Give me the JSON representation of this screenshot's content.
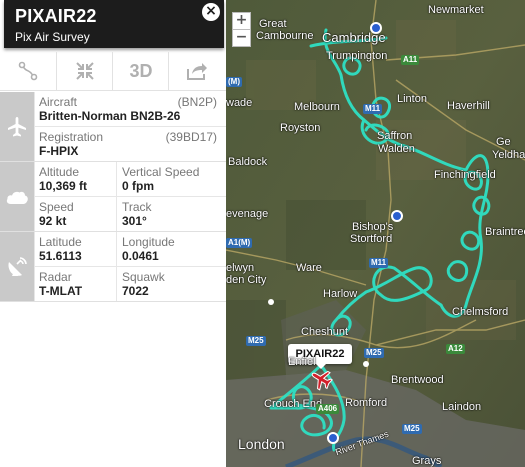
{
  "flight": {
    "callsign": "PIXAIR22",
    "operator": "Pix Air Survey",
    "close_icon": "×"
  },
  "toolbar": {
    "route_icon": "route-icon",
    "fullscreen_icon": "fullscreen-icon",
    "view_3d_label": "3D",
    "share_icon": "share-icon"
  },
  "aircraft": {
    "aircraft_label": "Aircraft",
    "aircraft_code": "(BN2P)",
    "aircraft_value": "Britten-Norman BN2B-26",
    "registration_label": "Registration",
    "registration_code": "(39BD17)",
    "registration_value": "F-HPIX"
  },
  "flight_data": {
    "altitude_label": "Altitude",
    "altitude_value": "10,369 ft",
    "vspeed_label": "Vertical Speed",
    "vspeed_value": "0 fpm",
    "speed_label": "Speed",
    "speed_value": "92 kt",
    "track_label": "Track",
    "track_value": "301°"
  },
  "position": {
    "latitude_label": "Latitude",
    "latitude_value": "51.6113",
    "longitude_label": "Longitude",
    "longitude_value": "0.0461",
    "radar_label": "Radar",
    "radar_value": "T-MLAT",
    "squawk_label": "Squawk",
    "squawk_value": "7022"
  },
  "map": {
    "zoom_in": "+",
    "zoom_out": "−",
    "flight_label": "PIXAIR22",
    "places": {
      "newmarket": "Newmarket",
      "great": "Great",
      "cambourne": "Cambourne",
      "cambridge": "Cambridge",
      "trumpington": "Trumpington",
      "linton": "Linton",
      "haverhill": "Haverhill",
      "melbourn": "Melbourn",
      "royston": "Royston",
      "saffron": "Saffron",
      "walden": "Walden",
      "wade": "wade",
      "baldock": "Baldock",
      "finchingfield": "Finchingfield",
      "ge": "Ge",
      "yeldha": "Yeldha",
      "braintree": "Braintree",
      "bishops": "Bishop's",
      "stortford": "Stortford",
      "evenage": "evenage",
      "elwyn": "elwyn",
      "den_city": "den City",
      "ware": "Ware",
      "harlow": "Harlow",
      "chelmsford": "Chelmsford",
      "cheshunt": "Cheshunt",
      "enfield": "Enfiel",
      "brentwood": "Brentwood",
      "romford": "Romford",
      "crouch_end": "Crouch End",
      "laindon": "Laindon",
      "london": "London",
      "river_thames": "River Thames",
      "grays": "Grays"
    },
    "roads": {
      "a11": "A11",
      "a1m_top": "(M)",
      "m11_top": "M11",
      "a1m": "A1(M)",
      "m11": "M11",
      "m25_west": "M25",
      "m25_east": "M25",
      "a12": "A12",
      "a406": "A406",
      "m25_se": "M25"
    }
  }
}
